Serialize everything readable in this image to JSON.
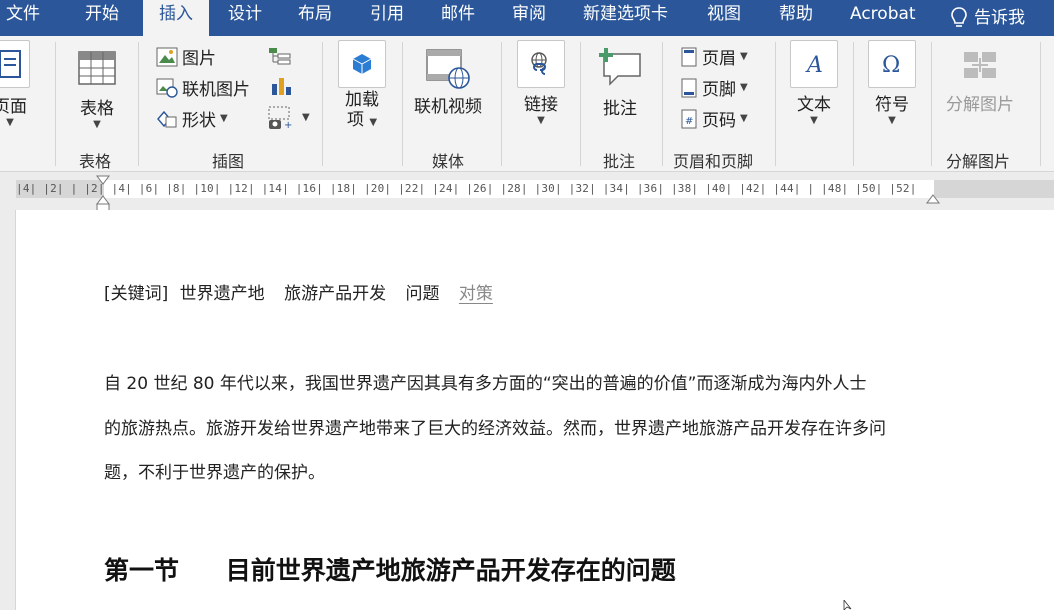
{
  "menu": {
    "tabs": [
      "文件",
      "开始",
      "插入",
      "设计",
      "布局",
      "引用",
      "邮件",
      "审阅",
      "新建选项卡",
      "视图",
      "帮助",
      "Acrobat"
    ],
    "active_tab": "插入",
    "tell_me": "告诉我"
  },
  "ribbon": {
    "pages": {
      "label": "页面"
    },
    "tables": {
      "button": "表格",
      "group": "表格"
    },
    "illustrations": {
      "picture": "图片",
      "online_picture": "联机图片",
      "shapes": "形状",
      "group": "插图"
    },
    "addins": {
      "line1": "加载",
      "line2": "项"
    },
    "media": {
      "online_video": "联机视频",
      "group": "媒体"
    },
    "links": {
      "button": "链接"
    },
    "comments": {
      "button": "批注",
      "group": "批注"
    },
    "header_footer": {
      "header": "页眉",
      "footer": "页脚",
      "page_number": "页码",
      "group": "页眉和页脚"
    },
    "text": {
      "button": "文本"
    },
    "symbols": {
      "button": "符号"
    },
    "decompose": {
      "button": "分解图片",
      "group": "分解图片"
    }
  },
  "ruler": {
    "ticks": "|4| |2| |  |2| |4| |6| |8| |10| |12| |14| |16| |18| |20| |22| |24| |26| |28| |30| |32| |34| |36| |38| |40| |42| |44|  |   |48| |50| |52|"
  },
  "document": {
    "keywords_label": "[关键词]",
    "keywords": [
      "世界遗产地",
      "旅游产品开发",
      "问题",
      "对策"
    ],
    "paragraph_lines": [
      "自 20 世纪 80 年代以来，我国世界遗产因其具有多方面的“突出的普遍的价值”而逐渐成为海内外人士",
      "的旅游热点。旅游开发给世界遗产地带来了巨大的经济效益。然而，世界遗产地旅游产品开发存在许多问",
      "题，不利于世界遗产的保护。"
    ],
    "heading_section": "第一节",
    "heading_title": "目前世界遗产地旅游产品开发存在的问题"
  },
  "colors": {
    "accent": "#2b579a",
    "ribbon_bg": "#f3f3f3"
  }
}
